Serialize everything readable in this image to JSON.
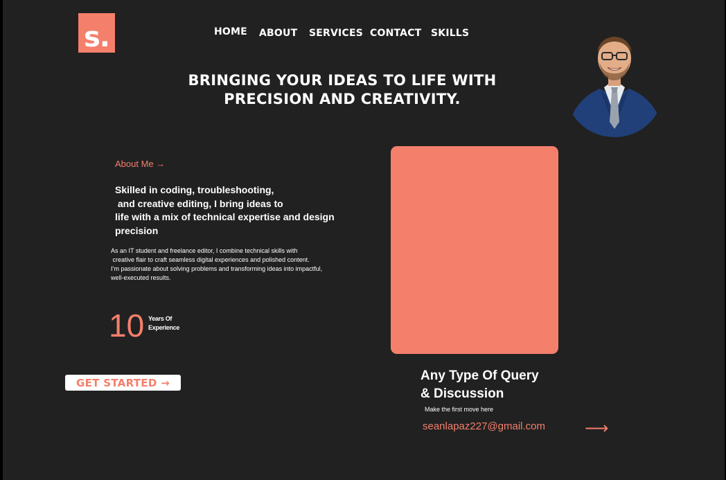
{
  "logo": {
    "text": "s."
  },
  "nav": {
    "items": [
      {
        "label": "Home"
      },
      {
        "label": "About"
      },
      {
        "label": "Services"
      },
      {
        "label": "Contact"
      },
      {
        "label": "Skills"
      }
    ]
  },
  "hero": {
    "headline_line1": "Bringing your ideas to life with",
    "headline_line2": "precision and creativity."
  },
  "about": {
    "link_label": "About Me →",
    "heading_lines": [
      "Skilled in coding, troubleshooting,",
      " and creative editing, I bring ideas to",
      "life with a mix of technical expertise and design",
      "precision"
    ],
    "body_lines": [
      "As an IT student and freelance editor, I combine technical skills with",
      " creative flair to craft seamless digital experiences and polished content.",
      "I’m passionate about solving problems and transforming ideas into impactful,",
      "well-executed results."
    ]
  },
  "experience": {
    "years": "10",
    "label_line1": "Years Of",
    "label_line2": "Experience"
  },
  "cta": {
    "label": "Get Started →"
  },
  "contact": {
    "title_line1": "Any Type Of Query",
    "title_line2": "& Discussion",
    "subtitle": "Make the first move here",
    "email": "seanlapaz227@gmail.com",
    "arrow": "⟶"
  },
  "colors": {
    "accent": "#f47f6b",
    "background": "#212121",
    "text": "#ffffff"
  }
}
